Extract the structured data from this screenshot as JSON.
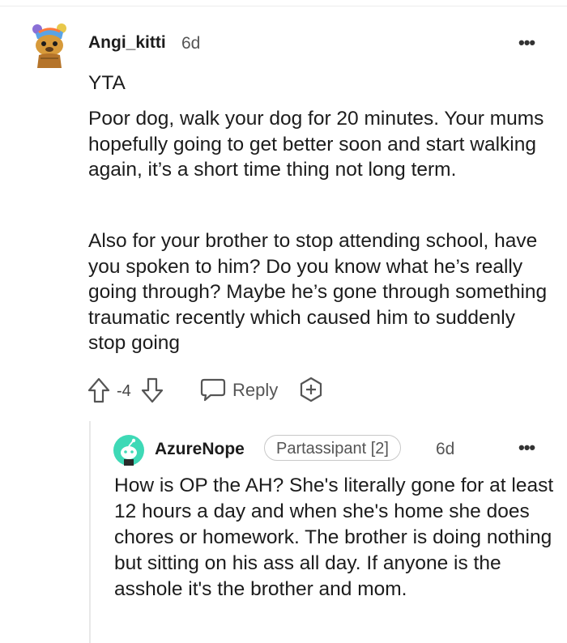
{
  "comment": {
    "author": "Angi_kitti",
    "time": "6d",
    "more_label": "•••",
    "paragraphs": [
      "YTA",
      "Poor dog, walk your dog for 20 minutes. Your mums hopefully going to get better soon and start walking again, it’s a short time thing not long term.",
      "Also for your brother to stop attending school, have you spoken to him? Do you know what he’s really going through? Maybe he’s gone through something traumatic recently which caused him to suddenly stop going"
    ],
    "score": "-4",
    "reply_label": "Reply",
    "icons": [
      "upvote-icon",
      "downvote-icon",
      "reply-bubble-icon",
      "award-icon"
    ]
  },
  "reply": {
    "author": "AzureNope",
    "flair": "Partassipant [2]",
    "time": "6d",
    "more_label": "•••",
    "text": "How is OP the AH? She's literally gone for at least 12 hours a day and when she's home she does chores or homework. The brother is doing nothing but sitting on his ass all day. If anyone is the asshole it's the brother and mom."
  },
  "colors": {
    "text": "#1c1c1c",
    "meta": "#555555",
    "avatar_teal": "#3ed9b6",
    "thread_line": "#e8e8e8"
  }
}
